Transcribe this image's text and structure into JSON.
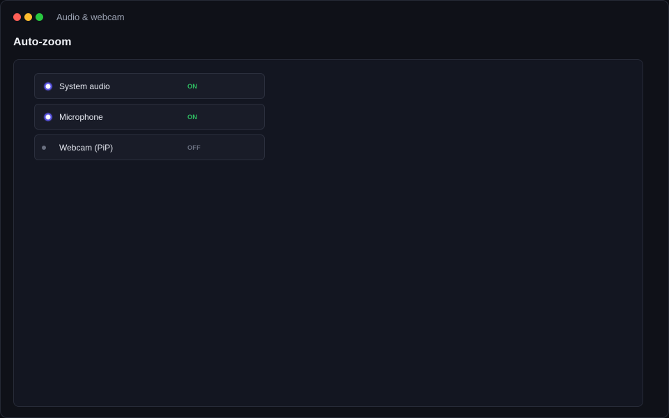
{
  "window": {
    "title": "Audio & webcam"
  },
  "section": {
    "title": "Auto-zoom"
  },
  "toggles": [
    {
      "label": "System audio",
      "state": "ON",
      "enabled": true
    },
    {
      "label": "Microphone",
      "state": "ON",
      "enabled": true
    },
    {
      "label": "Webcam (PiP)",
      "state": "OFF",
      "enabled": false
    }
  ],
  "colors": {
    "on": "#2fbf63",
    "off": "#6b7181",
    "accent": "#5b55e6",
    "close": "#ff5f57",
    "minimize": "#febc2e",
    "zoom": "#28c840"
  }
}
